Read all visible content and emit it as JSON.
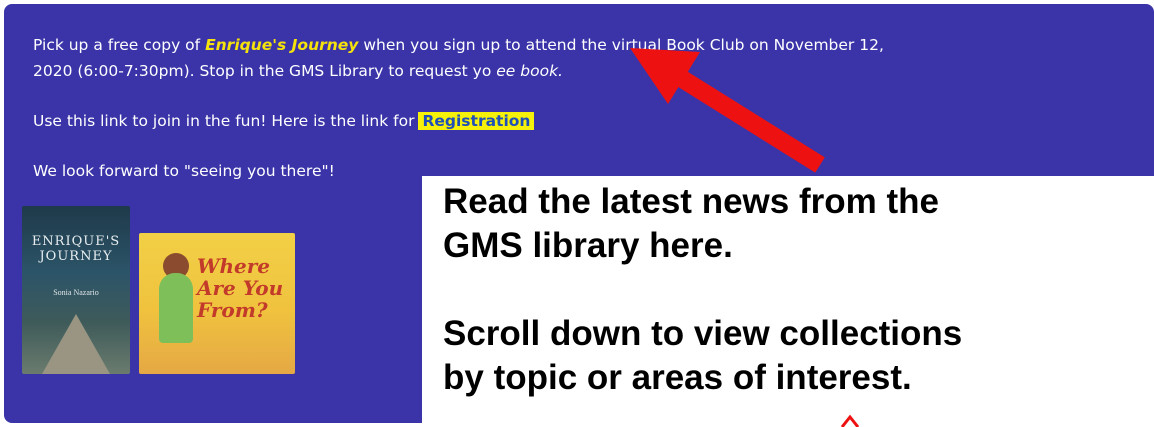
{
  "panel": {
    "line1_pre": "Pick up a free copy of ",
    "book_title": "Enrique's Journey",
    "line1_post": " when you sign up to attend the virtual Book Club on November 12,",
    "line2_pre": "2020  (6:00-7:30pm).  Stop in the GMS Library to request yo",
    "line2_italic": "ee book.",
    "line3_pre": "Use this link to join in the fun! Here is the link for",
    "registration_link": "Registration",
    "line4": "We look forward to \"seeing you there\"!"
  },
  "covers": {
    "book1": {
      "title_line1": "ENRIQUE'S",
      "title_line2": "JOURNEY",
      "author": "Sonia Nazario"
    },
    "book2": {
      "title_line1": "Where",
      "title_line2": "Are You",
      "title_line3": "From?"
    }
  },
  "overlay": {
    "line1": "Read the latest news from the",
    "line2": "GMS library here.",
    "line3": "Scroll down to view collections",
    "line4": "by topic or areas of interest."
  },
  "colors": {
    "panel_bg": "#3a34a8",
    "title_yellow": "#f5e20a",
    "link_highlight": "#f5f10a",
    "arrow_red": "#ee1111"
  }
}
